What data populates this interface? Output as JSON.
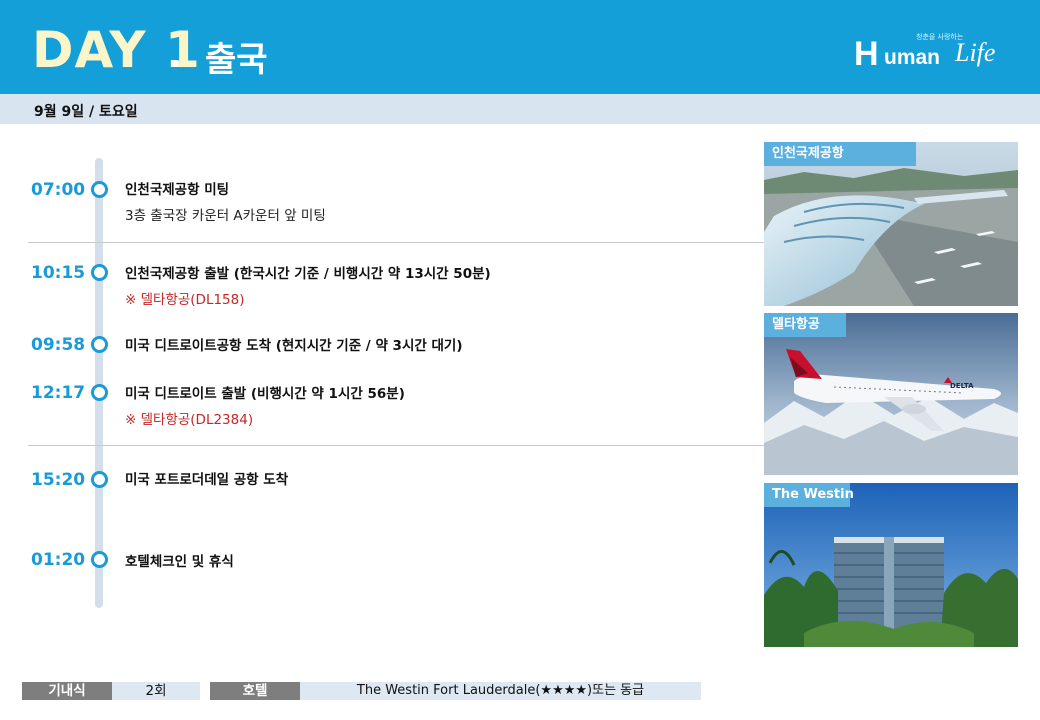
{
  "header": {
    "day_title": "DAY 1",
    "day_subtitle": "출국",
    "logo": {
      "tagline": "청춘을 사랑하는",
      "brand_h": "H",
      "brand_text": "uman",
      "brand_script": "Life"
    }
  },
  "date_bar": {
    "text": "9월 9일 / 토요일"
  },
  "schedule": [
    {
      "time": "07:00",
      "title": "인천국제공항 미팅",
      "detail": "3층 출국장 카운터 A카운터 앞 미팅"
    },
    {
      "time": "10:15",
      "title": "인천국제공항 출발 (한국시간 기준 / 비행시간 약 13시간 50분)",
      "note": "※ 델타항공(DL158)"
    },
    {
      "time": "09:58",
      "title": "미국 디트로이트공항 도착 (현지시간 기준 / 약 3시간 대기)"
    },
    {
      "time": "12:17",
      "title": "미국 디트로이트 출발 (비행시간 약 1시간 56분)",
      "note": "※ 델타항공(DL2384)"
    },
    {
      "time": "15:20",
      "title": "미국 포트로더데일 공항 도착"
    },
    {
      "time": "01:20",
      "title": "호텔체크인 및 휴식"
    }
  ],
  "photos": [
    {
      "label": "인천국제공항"
    },
    {
      "label": "델타항공",
      "livery": "DELTA"
    },
    {
      "label": "The Westin"
    }
  ],
  "footer": {
    "meal_label": "기내식",
    "meal_value": "2회",
    "hotel_label": "호텔",
    "hotel_value": "The Westin Fort Lauderdale(★★★★)또는 동급"
  },
  "colors": {
    "header_bg": "#159fd8",
    "title_yellow": "#fbf6c9",
    "time_blue": "#1a9ad6",
    "note_red": "#c62828",
    "date_bar_bg": "#d8e4ef"
  }
}
